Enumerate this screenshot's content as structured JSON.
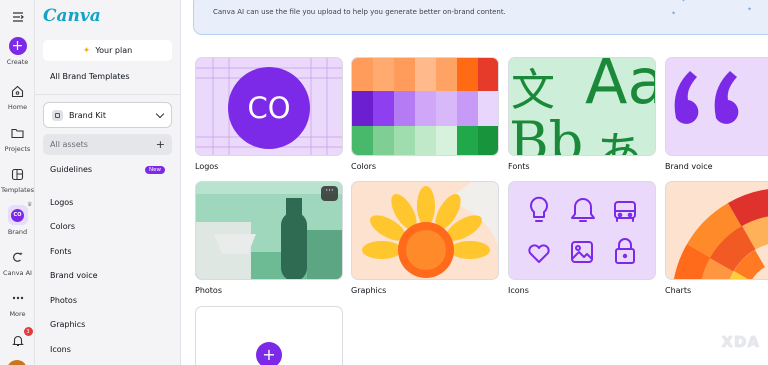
{
  "rail": {
    "create": "Create",
    "home": "Home",
    "projects": "Projects",
    "templates": "Templates",
    "brand": "Brand",
    "canva_ai": "Canva AI",
    "more": "More",
    "notifications_count": "3"
  },
  "panel": {
    "logo": "Canva",
    "your_plan": "Your plan",
    "all_brand_templates": "All Brand Templates",
    "brand_kit": "Brand Kit",
    "all_assets": "All assets",
    "guidelines": "Guidelines",
    "new_badge": "New",
    "items": [
      "Logos",
      "Colors",
      "Fonts",
      "Brand voice",
      "Photos",
      "Graphics",
      "Icons"
    ]
  },
  "main": {
    "banner_text": "Canva AI can use the file you upload to help you generate better on-brand content.",
    "logo_card_text": "CO",
    "fonts_card_glyphs": [
      "文",
      "Aa",
      "Bb",
      "あ"
    ],
    "cards": [
      {
        "label": "Logos"
      },
      {
        "label": "Colors"
      },
      {
        "label": "Fonts"
      },
      {
        "label": "Brand voice"
      },
      {
        "label": "Photos"
      },
      {
        "label": "Graphics"
      },
      {
        "label": "Icons"
      },
      {
        "label": "Charts"
      }
    ],
    "more_button": "···",
    "add_button": "+"
  },
  "watermark": "XDA",
  "colors": {
    "accent": "#7d2ae8",
    "logo_text": "#13a3c4",
    "banner_bg": "#e8effb",
    "panel_bg": "#f4f4f7",
    "logo_card_bg": "#ead9fb",
    "fonts_card_bg": "#cdeed8",
    "fonts_glyph": "#1a8a3a"
  },
  "icons": {
    "menu": "hamburger-menu-icon",
    "home": "home-icon",
    "projects": "folder-icon",
    "templates": "templates-icon",
    "canva_ai": "ai-sparkle-icon",
    "more": "more-dots-icon",
    "notifications": "bell-icon"
  }
}
